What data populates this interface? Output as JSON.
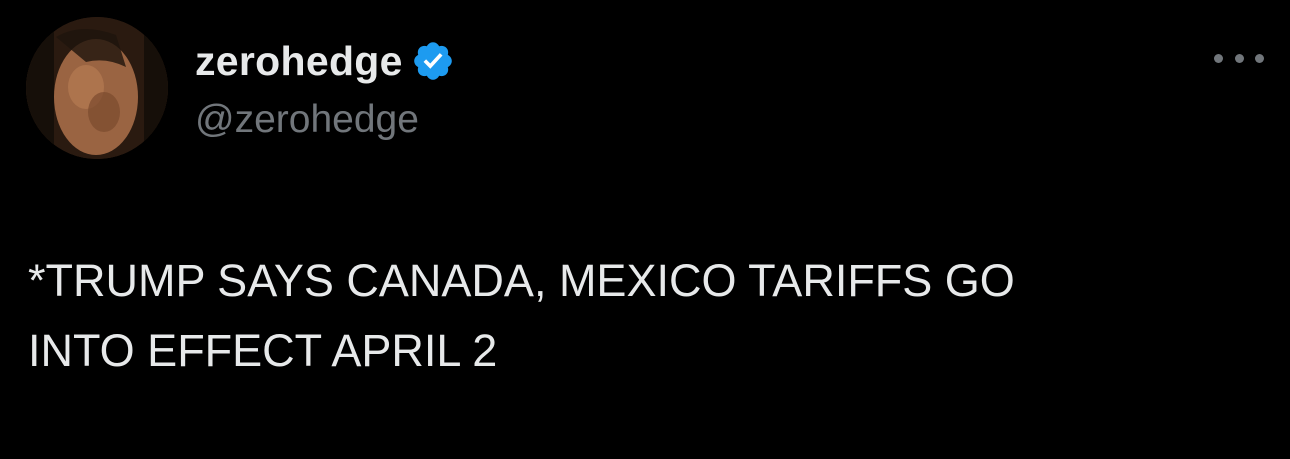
{
  "tweet": {
    "author": {
      "display_name": "zerohedge",
      "handle": "@zerohedge",
      "verified": true,
      "verified_color": "#1d9bf0"
    },
    "text": "*TRUMP SAYS CANADA, MEXICO TARIFFS GO\nINTO EFFECT APRIL 2",
    "icons": {
      "verified": "verified-badge-icon",
      "more": "more-options-icon"
    }
  },
  "theme": {
    "background": "#000000",
    "primary_text": "#e7e9ea",
    "secondary_text": "#71767b"
  }
}
